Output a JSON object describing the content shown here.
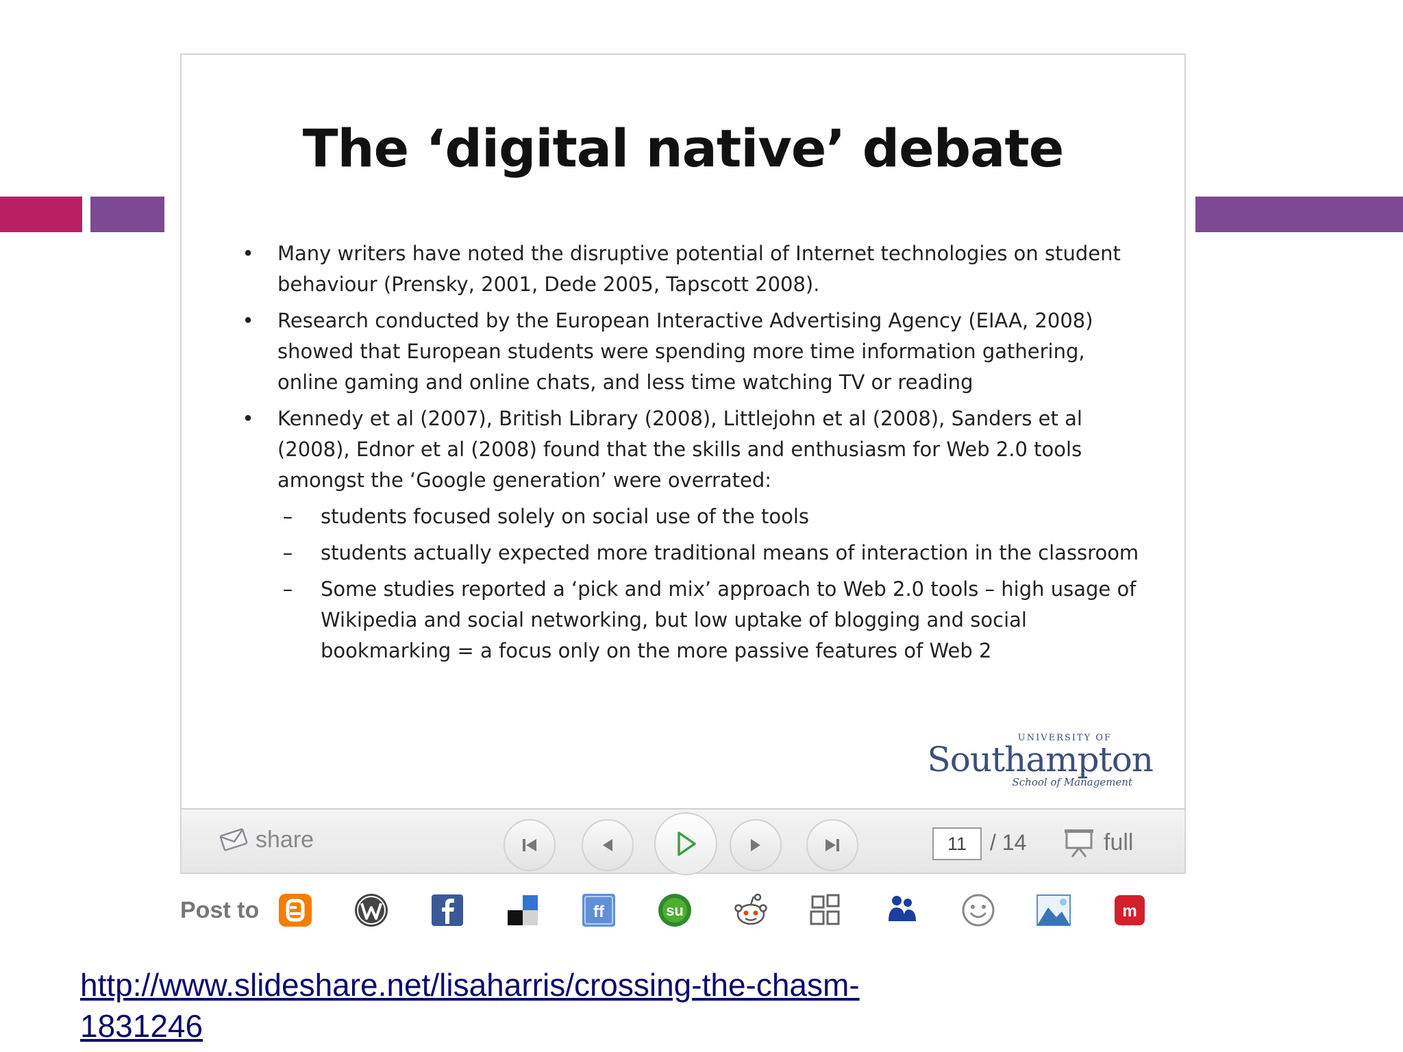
{
  "slide": {
    "title": "The ‘digital native’ debate",
    "bullets": [
      "Many writers have noted the disruptive potential of Internet technologies on student behaviour (Prensky, 2001,  Dede  2005, Tapscott 2008).",
      "Research conducted by the European Interactive Advertising Agency (EIAA, 2008) showed that European students were spending more time information gathering, online gaming and online chats, and less time  watching TV or reading",
      "Kennedy et al (2007), British Library (2008), Littlejohn et al (2008), Sanders et al (2008), Ednor et al (2008) found that the skills and enthusiasm for Web 2.0 tools amongst the ‘Google generation’ were overrated:"
    ],
    "subbullets": [
      "students focused solely on social use of the tools",
      "students actually expected more traditional means of interaction in the classroom",
      "Some studies reported a ‘pick and mix’ approach to Web 2.0 tools – high usage of Wikipedia and social networking,  but low uptake of blogging and social bookmarking = a focus only on the more passive features of Web 2"
    ],
    "bullet_glyph": "•",
    "sub_glyph": "–",
    "logo": {
      "small": "UNIVERSITY OF",
      "main": "Southampton",
      "sub": "School of Management"
    }
  },
  "toolbar": {
    "share_label": "share",
    "current_page": "11",
    "total_pages": "/ 14",
    "full_label": "full",
    "icons": [
      "share-icon",
      "first-slide-icon",
      "previous-slide-icon",
      "play-icon",
      "next-slide-icon",
      "last-slide-icon",
      "fullscreen-icon"
    ]
  },
  "post_to": {
    "label": "Post to",
    "targets": [
      "blogger",
      "wordpress",
      "facebook",
      "delicious",
      "friendfeed",
      "stumbleupon",
      "reddit",
      "mixx",
      "myspace",
      "smiley",
      "photobucket",
      "mixi"
    ]
  },
  "source_link": "http://www.slideshare.net/lisaharris/crossing-the-chasm-1831246",
  "colors": {
    "deco_pink": "#b81f63",
    "deco_purple": "#7b4a93",
    "play_green": "#3aa33a",
    "link": "#0a0a6e"
  }
}
